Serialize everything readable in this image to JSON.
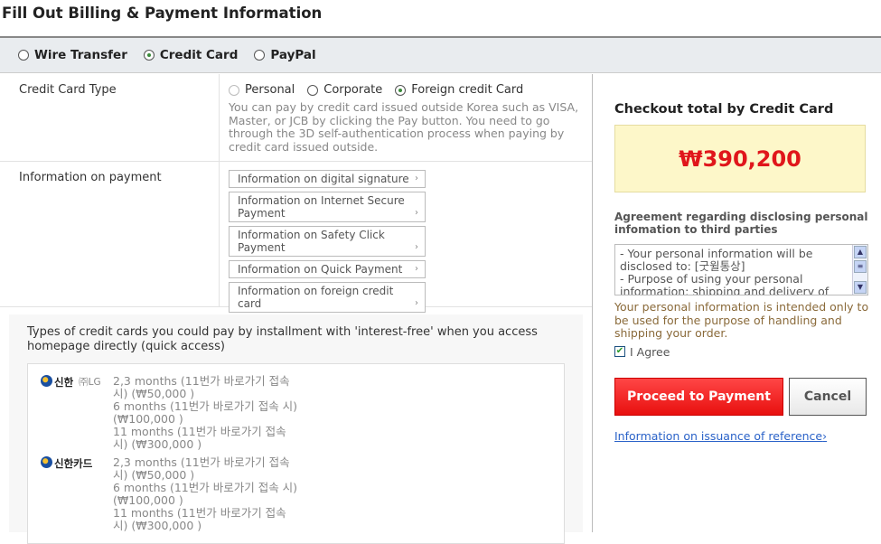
{
  "title": "Fill Out Billing & Payment Information",
  "methods": [
    "Wire Transfer",
    "Credit Card",
    "PayPal"
  ],
  "card_type": {
    "label": "Credit Card Type",
    "options": [
      "Personal",
      "Corporate",
      "Foreign credit Card"
    ],
    "note": "You can pay by credit card issued outside Korea such as VISA, Master, or JCB by clicking the Pay button. You need to go through the 3D self-authentication process when paying by credit card issued outside."
  },
  "payment_info": {
    "label": "Information on payment",
    "buttons": [
      "Information on digital signature",
      "Information on Internet Secure Payment",
      "Information on Safety Click Payment",
      "Information on Quick Payment",
      "Information on foreign credit card"
    ]
  },
  "installment": {
    "heading": "Types of credit cards you could pay by installment with 'interest-free' when you access homepage directly (quick access)",
    "cards": [
      {
        "logo": "신한",
        "logo_sub": "㈜LG",
        "plans": [
          "2,3 months (11번가 바로가기 접속 시) (₩50,000  )",
          "6 months (11번가 바로가기 접속 시) (₩100,000  )",
          "11 months (11번가 바로가기 접속 시) (₩300,000  )"
        ]
      },
      {
        "logo": "신한카드",
        "logo_sub": "",
        "plans": [
          "2,3 months (11번가 바로가기 접속 시) (₩50,000  )",
          "6 months (11번가 바로가기 접속 시) (₩100,000  )",
          "11 months (11번가 바로가기 접속 시) (₩300,000  )"
        ]
      }
    ]
  },
  "checkout": {
    "title": "Checkout total by Credit Card",
    "total": "₩390,200"
  },
  "agreement": {
    "title": "Agreement regarding disclosing personal infomation to third parties",
    "text": "- Your personal information will be disclosed to: [굿윌통상]\n- Purpose of using your personal information: shipping and delivery of",
    "notice": "Your personal information is intended only to be used for the purpose of handling and shipping your order.",
    "agree_label": "I Agree",
    "agreed": true
  },
  "actions": {
    "proceed": "Proceed to Payment",
    "cancel": "Cancel",
    "reference_link": "Information on issuance of reference"
  },
  "selected_method": "Credit Card",
  "selected_card_type": "Foreign credit Card"
}
